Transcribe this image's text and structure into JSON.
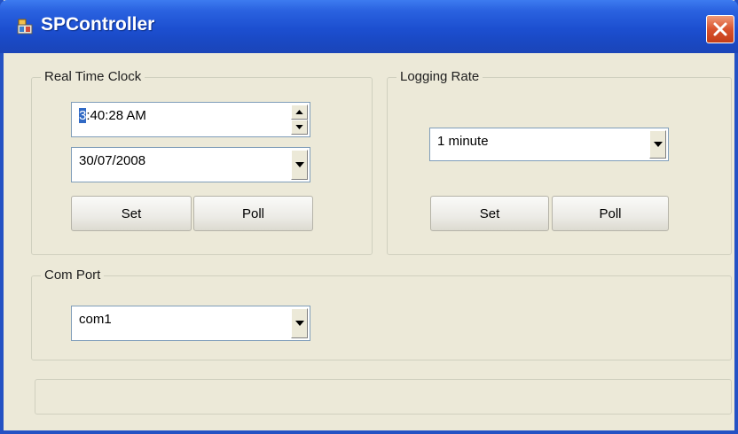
{
  "window": {
    "title": "SPController"
  },
  "rtc": {
    "group_label": "Real Time Clock",
    "time_highlight": "3",
    "time_rest": ":40:28 AM",
    "date_value": "30/07/2008",
    "set_label": "Set",
    "poll_label": "Poll"
  },
  "logging": {
    "group_label": "Logging Rate",
    "rate_value": "1 minute",
    "set_label": "Set",
    "poll_label": "Poll"
  },
  "comport": {
    "group_label": "Com Port",
    "port_value": "com1"
  },
  "icons": [
    "app-icon",
    "close-icon",
    "spin-up-icon",
    "spin-down-icon",
    "dropdown-arrow-icon"
  ],
  "colors": {
    "titlebar": "#1c4fd0",
    "close": "#d9532e",
    "window_bg": "#ece9d8"
  }
}
